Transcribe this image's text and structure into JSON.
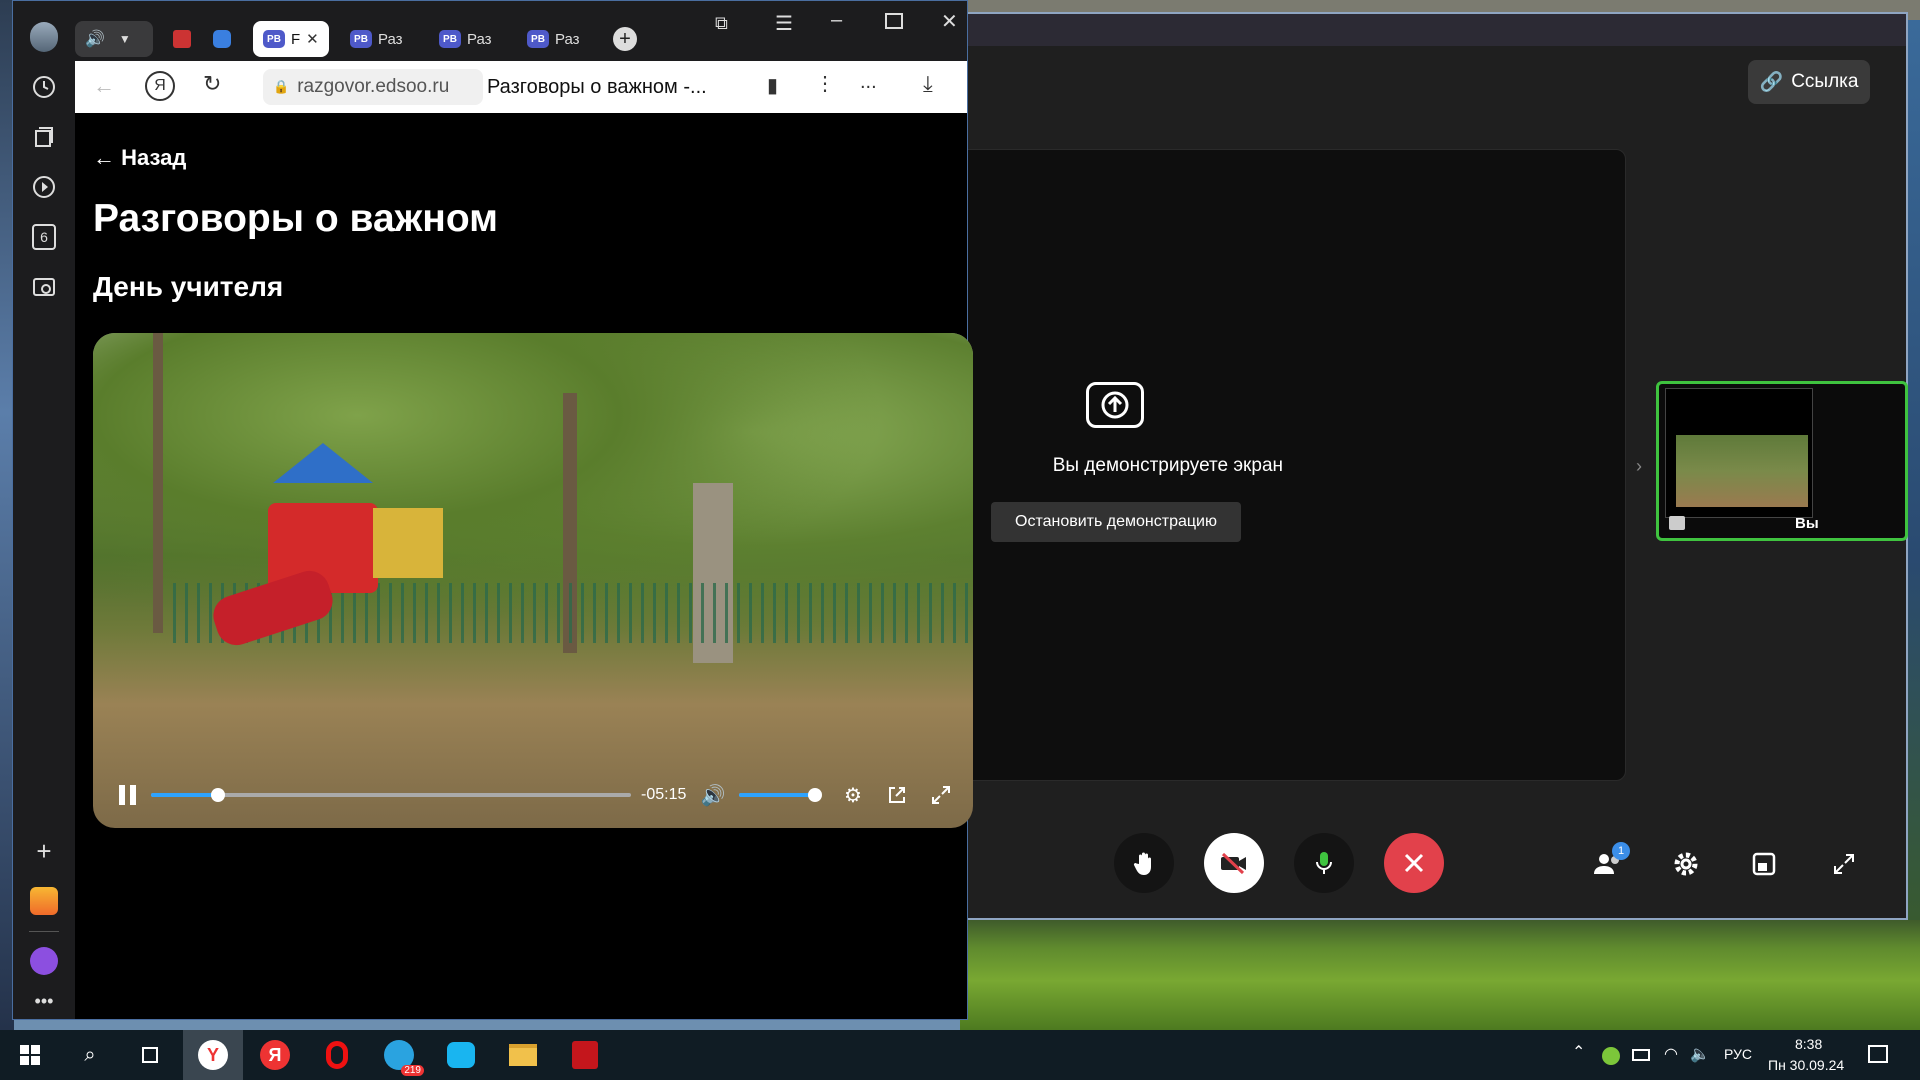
{
  "meeting": {
    "link_label": "Ссылка",
    "sharing_text": "Вы демонстрируете экран",
    "stop_share_label": "Остановить демонстрацию",
    "self_label": "Вы",
    "participants_badge": "1",
    "colors": {
      "accent_green": "#3fc33f",
      "end_call": "#e2414b",
      "badge": "#3b8ee8"
    }
  },
  "browser": {
    "sidebar_counter": "6",
    "tabs": [
      {
        "label": "F",
        "icon": "РВ",
        "active": true
      },
      {
        "label": "Раз",
        "icon": "РВ"
      },
      {
        "label": "Раз",
        "icon": "РВ"
      },
      {
        "label": "Раз",
        "icon": "РВ"
      }
    ],
    "url": "razgovor.edsoo.ru",
    "page_title": "Разговоры о важном -...",
    "more_label": "..."
  },
  "page": {
    "back": "← Назад",
    "title": "Разговоры о важном",
    "subtitle": "День учителя"
  },
  "video": {
    "remaining": "-05:15",
    "progress": 0.14,
    "volume": 1.0
  },
  "taskbar": {
    "telegram_badge": "219",
    "language": "РУС",
    "time": "8:38",
    "date": "Пн 30.09.24"
  }
}
